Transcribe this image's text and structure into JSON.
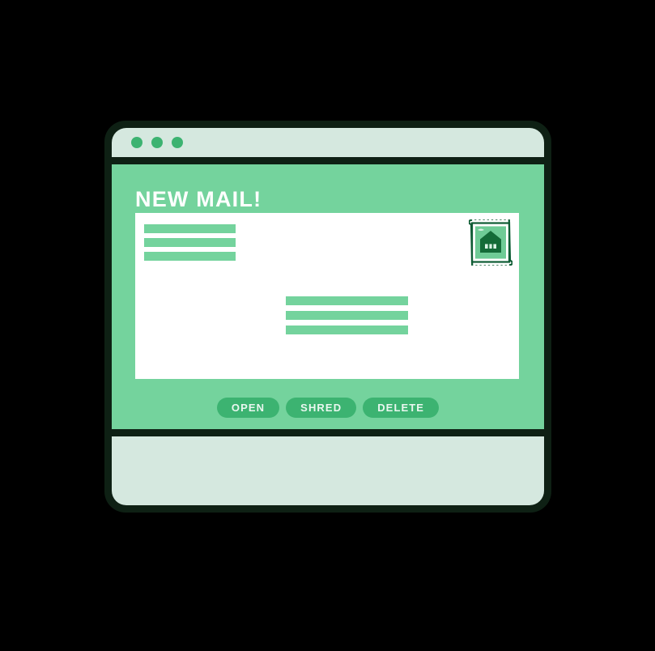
{
  "window": {
    "title_bar": {
      "dots": [
        "window-dot-1",
        "window-dot-2",
        "window-dot-3"
      ],
      "dot_color": "#3CB371",
      "background": "#D5E8DF"
    },
    "frame_color": "#0E2014",
    "body_background": "#74D39D",
    "footer_background": "#D5E8DF"
  },
  "main": {
    "heading": "NEW MAIL!",
    "heading_color": "#FFFFFF",
    "card": {
      "background": "#FFFFFF",
      "placeholder_color": "#74D39D",
      "sender_lines": [
        "line-1",
        "line-2",
        "line-3"
      ],
      "body_lines": [
        "line-1",
        "line-2",
        "line-3"
      ],
      "stamp": {
        "icon": "postage-stamp-icon",
        "inner_icon": "mailbox-house-icon",
        "border_color": "#0E5C34",
        "fill_color": "#6FCB96",
        "accent_color": "#146B38"
      }
    }
  },
  "actions": {
    "accent_color": "#3CB371",
    "label_color": "#EAF7F0",
    "buttons": [
      {
        "label": "OPEN",
        "name": "open-button"
      },
      {
        "label": "SHRED",
        "name": "shred-button"
      },
      {
        "label": "DELETE",
        "name": "delete-button"
      }
    ]
  }
}
